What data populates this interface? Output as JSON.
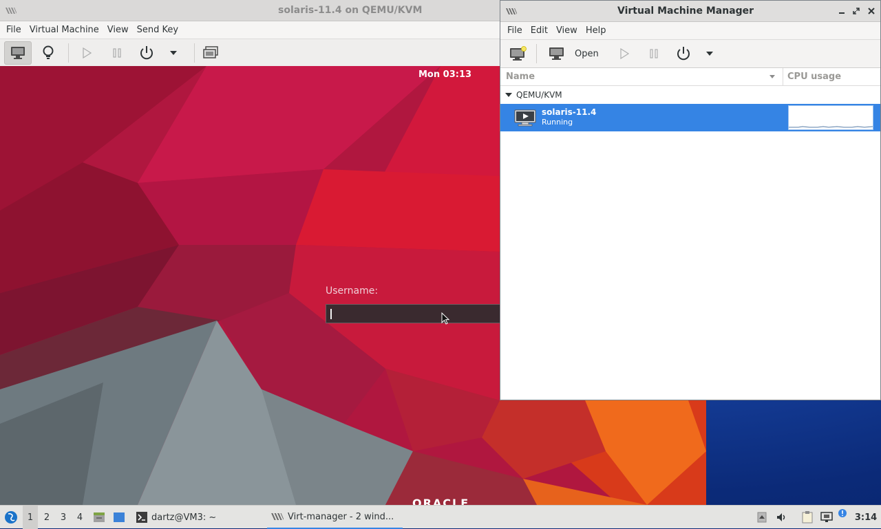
{
  "viewer": {
    "title": "solaris-11.4 on QEMU/KVM",
    "menu": [
      "File",
      "Virtual Machine",
      "View",
      "Send Key"
    ],
    "toolbar_icons": [
      "console-icon",
      "details-lightbulb-icon",
      "run-icon",
      "pause-icon",
      "power-icon",
      "power-menu-chevron-icon",
      "fullscreen-icon"
    ]
  },
  "guest": {
    "clock": "Mon 03:13",
    "username_label": "Username:",
    "username_value": "",
    "brand_text": "ORACLE"
  },
  "vmm": {
    "title": "Virtual Machine Manager",
    "menu": [
      "File",
      "Edit",
      "View",
      "Help"
    ],
    "toolbar": {
      "open_label": "Open"
    },
    "columns": {
      "name": "Name",
      "cpu": "CPU usage"
    },
    "group": "QEMU/KVM",
    "vms": [
      {
        "name": "solaris-11.4",
        "state": "Running",
        "cpu_usage_level": 0.05
      }
    ]
  },
  "taskbar": {
    "workspaces": [
      "1",
      "2",
      "3",
      "4"
    ],
    "active_workspace": "1",
    "tasks": [
      {
        "label": "dartz@VM3: ~",
        "icon": "terminal-icon"
      },
      {
        "label": "Virt-manager - 2 wind...",
        "icon": "virt-manager-icon",
        "active": true
      }
    ],
    "clock": "3:14"
  },
  "colors": {
    "selection": "#3584e4",
    "guest_bg_red": "#c8143f",
    "desktop_blue": "#0c2f86"
  }
}
